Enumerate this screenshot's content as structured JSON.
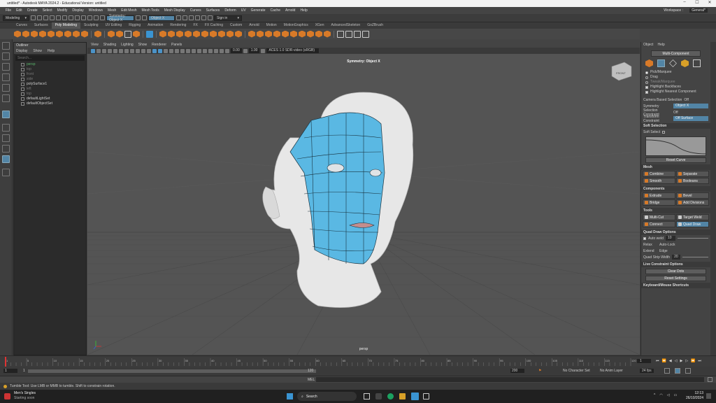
{
  "window": {
    "title": "untitled* - Autodesk MAYA 2024.2 - Educational Version: untitled",
    "controls": [
      "–",
      "☐",
      "✕"
    ]
  },
  "menus": [
    "File",
    "Edit",
    "Create",
    "Select",
    "Modify",
    "Display",
    "Windows",
    "Mesh",
    "Edit Mesh",
    "Mesh Tools",
    "Mesh Display",
    "Curves",
    "Surfaces",
    "Deform",
    "UV",
    "Generate",
    "Cache",
    "Arnold",
    "Help"
  ],
  "workspace": {
    "label": "Workspace :",
    "value": "General*"
  },
  "status": {
    "menuset": "Modeling",
    "symmetry": "Symmetry: Object X",
    "object_field": "Object X",
    "signin": "Sign in"
  },
  "shelf_tabs": [
    "Curves",
    "Surfaces",
    "Poly Modeling",
    "Sculpting",
    "UV Editing",
    "Rigging",
    "Animation",
    "Rendering",
    "FX",
    "FX Caching",
    "Custom",
    "Arnold",
    "Motion",
    "MotionGraphics",
    "XGen",
    "AdvancedSkeleton",
    "GoZBrush"
  ],
  "shelf_active": "Poly Modeling",
  "outliner": {
    "title": "Outliner",
    "menu": [
      "Display",
      "Show",
      "Help"
    ],
    "search": "Search...",
    "items": [
      "persp",
      "top",
      "front",
      "side",
      "polySurface1",
      "left",
      "top",
      "defaultLightSet",
      "defaultObjectSet"
    ]
  },
  "viewport": {
    "menu": [
      "View",
      "Shading",
      "Lighting",
      "Show",
      "Renderer",
      "Panels"
    ],
    "exposure": "0.00",
    "gamma": "1.00",
    "colorspace": "ACES 1.0 SDR-video (sRGB)",
    "symmetry_label": "Symmetry: Object X",
    "camera": "persp",
    "viewcube": "FRONT"
  },
  "attr": {
    "menu": [
      "Object",
      "Help"
    ],
    "multi_component": "Multi-Component",
    "pick_options": [
      {
        "label": "Pick/Marquee",
        "on": true
      },
      {
        "label": "Drag",
        "on": false
      },
      {
        "label": "Tweak/Marquee",
        "on": false
      }
    ],
    "checks": [
      "Highlight Backfaces",
      "Highlight Nearest Component"
    ],
    "camera_based": "Camera Based Selection",
    "camera_based_val": "Off",
    "symmetry_label": "Symmetry",
    "symmetry_val": "Object X",
    "selection_constraint": "Selection Constraint",
    "selection_constraint_val": "Off",
    "transform_constraint": "Transform Constraint",
    "transform_constraint_val": "Off Surface",
    "soft_selection": "Soft Selection",
    "soft_select": "Soft Select",
    "reset_curve": "Reset Curve",
    "mesh_section": "Mesh",
    "mesh_buttons": [
      "Combine",
      "Separate",
      "Smooth",
      "Booleans"
    ],
    "components_section": "Components",
    "comp_buttons": [
      "Extrude",
      "Bevel",
      "Bridge",
      "Add Divisions"
    ],
    "tools_section": "Tools",
    "tool_buttons": [
      "Multi-Cut",
      "Target Weld",
      "Connect",
      "Quad Draw"
    ],
    "quad_draw_options": "Quad Draw Options",
    "auto_weld": "Auto weld",
    "auto_weld_val": "10",
    "relax": "Relax",
    "relax_val": "Auto-Lock",
    "extend": "Extend",
    "extend_val": "Edge",
    "quad_strip_width": "Quad Strip Width",
    "quad_strip_val": "20",
    "live_constraint": "Live Constraint Options",
    "clear_dots": "Clear Dots",
    "reset_settings": "Reset Settings",
    "keyboard_shortcuts": "Keyboard/Mouse Shortcuts"
  },
  "timeline": {
    "ticks": [
      "1",
      "5",
      "10",
      "15",
      "20",
      "25",
      "30",
      "35",
      "40",
      "45",
      "50",
      "55",
      "60",
      "65",
      "70",
      "75",
      "80",
      "85",
      "90",
      "95",
      "100",
      "105",
      "110",
      "115",
      "120"
    ],
    "current": "1"
  },
  "range": {
    "start": "1",
    "start2": "1",
    "end_inner": "120",
    "end_outer": "200",
    "char_set": "No Character Set",
    "anim_layer": "No Anim Layer",
    "fps": "24 fps"
  },
  "cmd": {
    "label": "MEL"
  },
  "help": "Tumble Tool: Use LMB or MMB to tumble. Shift to constrain rotation.",
  "taskbar": {
    "song": "Men's Singles",
    "song_sub": "Starting soon",
    "search": "Search",
    "time": "12:13",
    "date": "26/10/2024"
  }
}
